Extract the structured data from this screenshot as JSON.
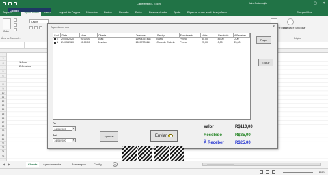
{
  "window": {
    "doc_title": "Cabeleireiro  -  Excel",
    "user": "Jairo Coltamoglio",
    "min": "—",
    "max": "▢",
    "close": "✕"
  },
  "ribbon_tabs": [
    {
      "label": "Arquivo"
    },
    {
      "label": "Página Inicial"
    },
    {
      "label": "Inserir"
    },
    {
      "label": "Layout da Página"
    },
    {
      "label": "Fórmulas"
    },
    {
      "label": "Dados"
    },
    {
      "label": "Revisão"
    },
    {
      "label": "Exibir"
    },
    {
      "label": "Desenvolvedor"
    },
    {
      "label": "Ajuda"
    }
  ],
  "tell_me": "Diga-me o que você deseja fazer",
  "share": "Compartilhar",
  "ribbon": {
    "paste_label": "Colar",
    "font_name": "Calibri",
    "clipboard_group": "Área de Transferê...",
    "fill_label": "Classificar e Filtrar",
    "find_label": "Localizar e Selecionar",
    "edit_group": "Edição"
  },
  "formula_bar": {
    "namebox": ""
  },
  "grid": {
    "header_cell": "Codigo",
    "cells": [
      "1 Jean",
      "2 Jessica"
    ],
    "row_numbers": [
      "1",
      "2",
      "3",
      "4",
      "5",
      "6",
      "7",
      "8",
      "9",
      "10",
      "11",
      "12",
      "13",
      "14",
      "15",
      "16",
      "17",
      "18",
      "19",
      "20",
      "21",
      "22",
      "23",
      "24",
      "25"
    ]
  },
  "dialog": {
    "title": "Agendamentos",
    "close": "×",
    "table": {
      "headers": [
        "Cod",
        "Data",
        "Hora",
        "Cliente",
        "Telefone",
        "Serviço",
        "Funcionario",
        "Valor",
        "Recebido",
        "A Receber"
      ],
      "rows": [
        [
          "2",
          "24/05/2020",
          "00:00:00",
          "Jean",
          "16994357468",
          "Barba",
          "Pedro",
          "85,00",
          "85,00",
          "0,00"
        ],
        [
          "1",
          "24/05/2020",
          "00:00:00",
          "Jessica",
          "16997303110",
          "Corte de Cabelo",
          "Pedro",
          "25,00",
          "0,00",
          "25,00"
        ]
      ]
    },
    "pagar_label": "Pagar",
    "excluir_label": "Excluir",
    "de_label": "De",
    "ate_label": "Até",
    "de_value": "24/05/2020",
    "ate_value": "24/05/2020",
    "agendar_label": "Agendar",
    "enviar_label": "Enviar"
  },
  "summary": {
    "valor_label": "Valor",
    "valor_value": "R$110,00",
    "recebido_label": "Recebido",
    "recebido_value": "R$85,00",
    "areceber_label": "À Receber",
    "areceber_value": "R$25,00",
    "colors": {
      "valor": "#000000",
      "recebido": "#1a7f1a",
      "areceber": "#1f2fd0"
    }
  },
  "sheet_tabs": [
    {
      "label": "Cliente"
    },
    {
      "label": "Agendamentos"
    },
    {
      "label": "Mensagem"
    },
    {
      "label": "Config"
    }
  ],
  "status": {
    "zoom": "100%"
  },
  "colors": {
    "excel_green": "#217346"
  }
}
